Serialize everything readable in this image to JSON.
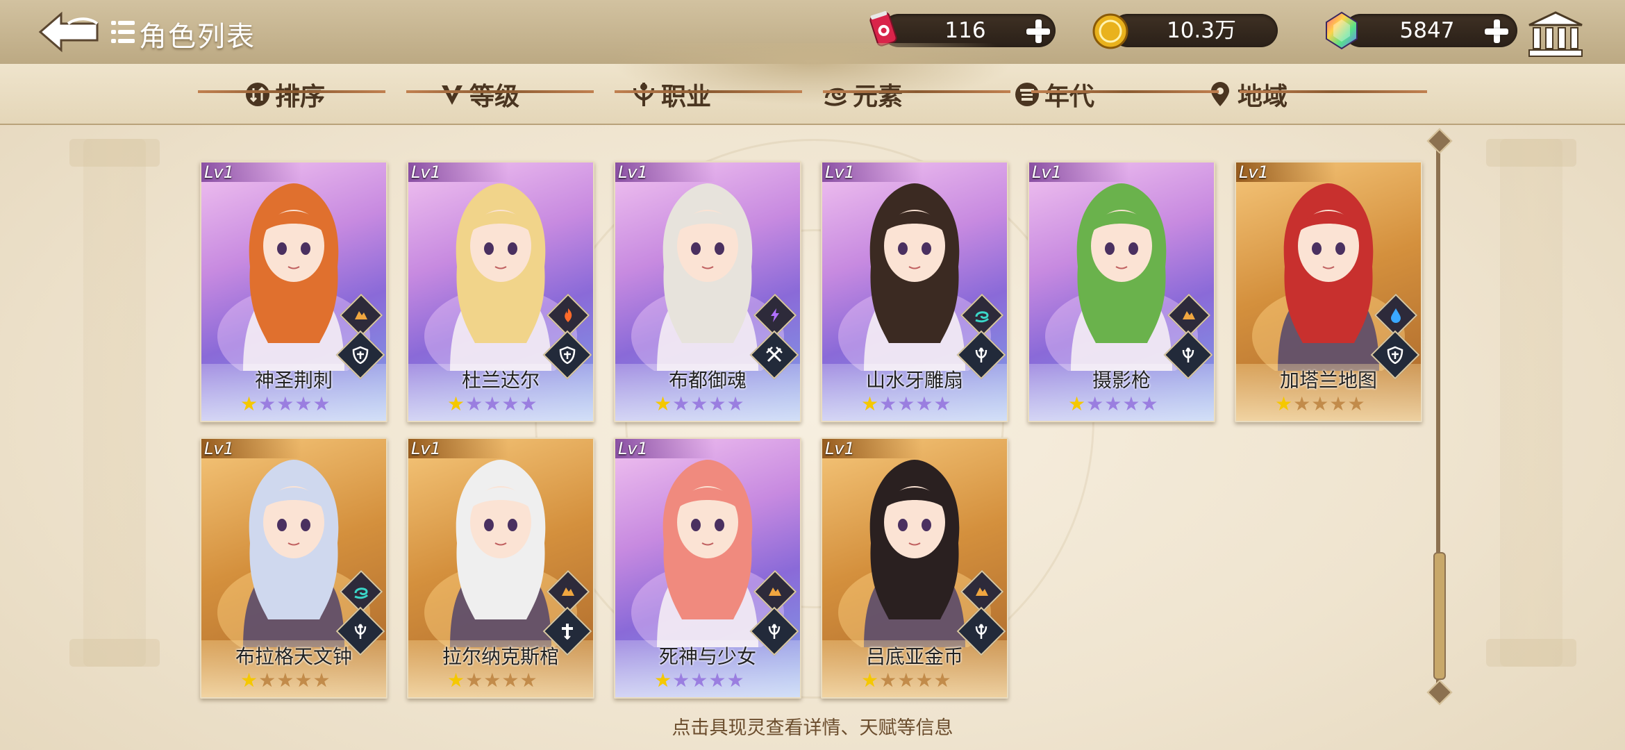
{
  "header": {
    "title": "角色列表",
    "resources": [
      {
        "name": "stamina",
        "icon": "soda-can-icon",
        "value": "116"
      },
      {
        "name": "gold",
        "icon": "gold-coin-icon",
        "value": "10.3万"
      },
      {
        "name": "gem",
        "icon": "rainbow-gem-icon",
        "value": "5847"
      }
    ]
  },
  "filters": [
    {
      "label": "排序",
      "icon": "sort-icon"
    },
    {
      "label": "等级",
      "icon": "level-v-icon"
    },
    {
      "label": "职业",
      "icon": "class-icon"
    },
    {
      "label": "元素",
      "icon": "element-swirl-icon"
    },
    {
      "label": "年代",
      "icon": "era-icon"
    },
    {
      "label": "地域",
      "icon": "location-pin-icon"
    }
  ],
  "cards": [
    {
      "level": "Lv1",
      "name": "神圣荆刺",
      "rarity": "purple",
      "element": "earth",
      "class": "shield",
      "stars_filled": 1,
      "stars_total": 5
    },
    {
      "level": "Lv1",
      "name": "杜兰达尔",
      "rarity": "purple",
      "element": "fire",
      "class": "shield",
      "stars_filled": 1,
      "stars_total": 5
    },
    {
      "level": "Lv1",
      "name": "布都御魂",
      "rarity": "purple",
      "element": "thunder",
      "class": "swords",
      "stars_filled": 1,
      "stars_total": 5
    },
    {
      "level": "Lv1",
      "name": "山水牙雕扇",
      "rarity": "purple",
      "element": "wind",
      "class": "trident",
      "stars_filled": 1,
      "stars_total": 5
    },
    {
      "level": "Lv1",
      "name": "摄影枪",
      "rarity": "purple",
      "element": "earth",
      "class": "trident",
      "stars_filled": 1,
      "stars_total": 5
    },
    {
      "level": "Lv1",
      "name": "加塔兰地图",
      "rarity": "gold",
      "element": "water",
      "class": "shield",
      "stars_filled": 1,
      "stars_total": 5
    },
    {
      "level": "Lv1",
      "name": "布拉格天文钟",
      "rarity": "gold",
      "element": "wind",
      "class": "trident",
      "stars_filled": 1,
      "stars_total": 5
    },
    {
      "level": "Lv1",
      "name": "拉尔纳克斯棺",
      "rarity": "gold",
      "element": "earth",
      "class": "cross",
      "stars_filled": 1,
      "stars_total": 5
    },
    {
      "level": "Lv1",
      "name": "死神与少女",
      "rarity": "purple",
      "element": "earth",
      "class": "trident",
      "stars_filled": 1,
      "stars_total": 5
    },
    {
      "level": "Lv1",
      "name": "吕底亚金币",
      "rarity": "gold",
      "element": "earth",
      "class": "trident",
      "stars_filled": 1,
      "stars_total": 5
    }
  ],
  "footer_hint": "点击具现灵查看详情、天赋等信息",
  "colors": {
    "star_filled": "#f5c800",
    "star_empty_purple": "#9a7ee0",
    "star_empty_gold": "#c28b4a"
  }
}
